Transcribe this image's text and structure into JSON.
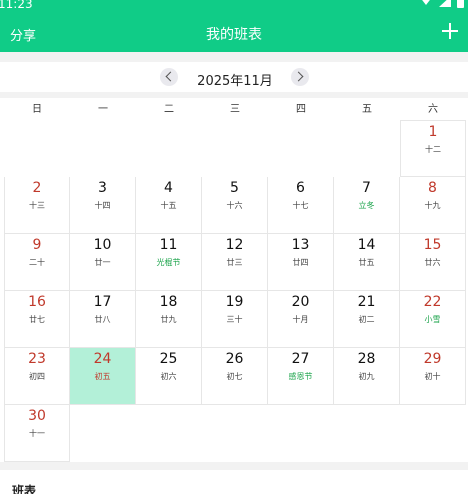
{
  "status_bar": {
    "time": "11:23"
  },
  "header": {
    "share_label": "分享",
    "title": "我的班表"
  },
  "month_nav": {
    "label": "2025年11月"
  },
  "weekdays": [
    "日",
    "一",
    "二",
    "三",
    "四",
    "五",
    "六"
  ],
  "days": [
    {
      "day": "1",
      "lunar": "十二",
      "weekend": true
    },
    {
      "day": "2",
      "lunar": "十三",
      "weekend": true
    },
    {
      "day": "3",
      "lunar": "十四"
    },
    {
      "day": "4",
      "lunar": "十五"
    },
    {
      "day": "5",
      "lunar": "十六"
    },
    {
      "day": "6",
      "lunar": "十七"
    },
    {
      "day": "7",
      "lunar": "立冬",
      "festival": true
    },
    {
      "day": "8",
      "lunar": "十九",
      "weekend": true
    },
    {
      "day": "9",
      "lunar": "二十",
      "weekend": true
    },
    {
      "day": "10",
      "lunar": "廿一"
    },
    {
      "day": "11",
      "lunar": "光棍节",
      "festival": true
    },
    {
      "day": "12",
      "lunar": "廿三"
    },
    {
      "day": "13",
      "lunar": "廿四"
    },
    {
      "day": "14",
      "lunar": "廿五"
    },
    {
      "day": "15",
      "lunar": "廿六",
      "weekend": true
    },
    {
      "day": "16",
      "lunar": "廿七",
      "weekend": true
    },
    {
      "day": "17",
      "lunar": "廿八"
    },
    {
      "day": "18",
      "lunar": "廿九"
    },
    {
      "day": "19",
      "lunar": "三十"
    },
    {
      "day": "20",
      "lunar": "十月"
    },
    {
      "day": "21",
      "lunar": "初二"
    },
    {
      "day": "22",
      "lunar": "小雪",
      "weekend": true,
      "festival": true
    },
    {
      "day": "23",
      "lunar": "初四",
      "weekend": true
    },
    {
      "day": "24",
      "lunar": "初五",
      "today": true
    },
    {
      "day": "25",
      "lunar": "初六"
    },
    {
      "day": "26",
      "lunar": "初七"
    },
    {
      "day": "27",
      "lunar": "感恩节",
      "festival": true
    },
    {
      "day": "28",
      "lunar": "初九"
    },
    {
      "day": "29",
      "lunar": "初十",
      "weekend": true
    },
    {
      "day": "30",
      "lunar": "十一",
      "weekend": true
    }
  ],
  "first_weekday_index": 6,
  "bottom_panel": {
    "title": "班表"
  },
  "colors": {
    "accent": "#10cc87",
    "weekend": "#c0392b",
    "festival": "#1aa34a",
    "today_bg": "#b3f0d8"
  }
}
